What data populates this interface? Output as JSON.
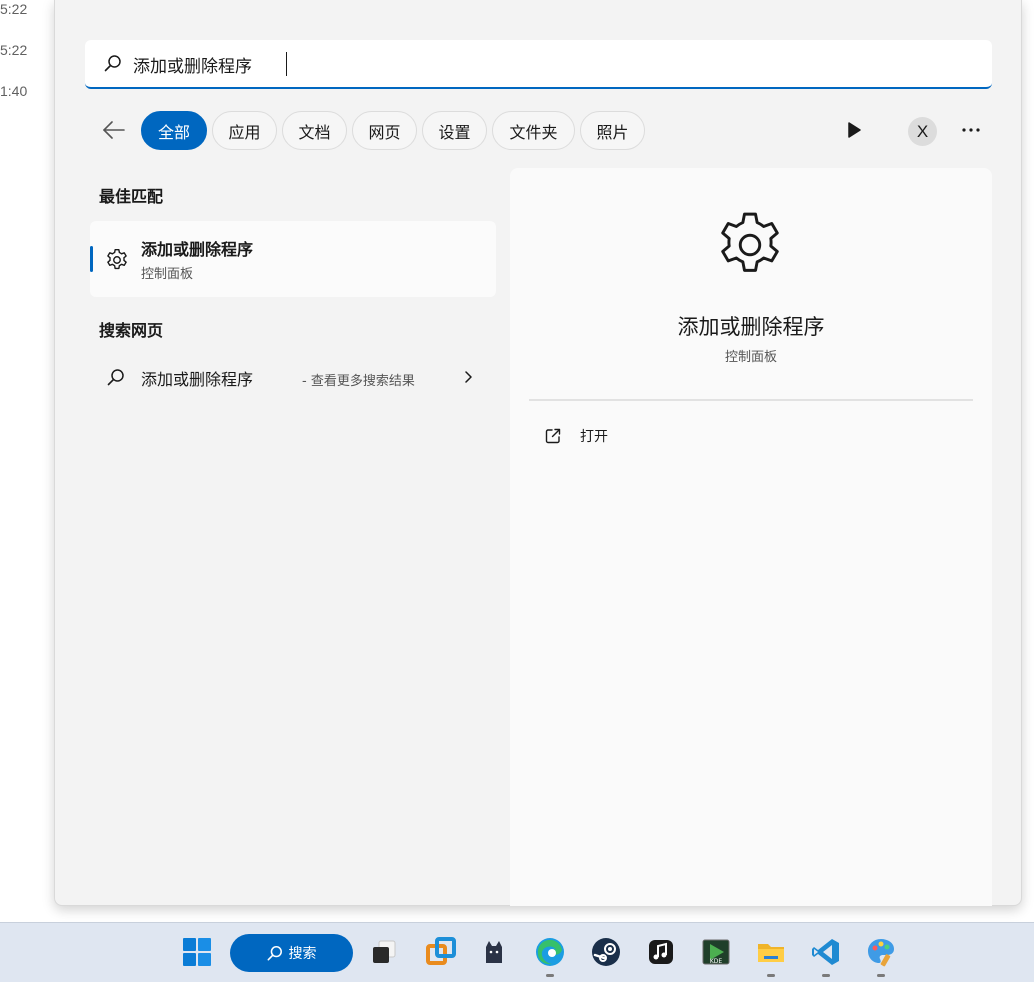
{
  "background_times": [
    "5:22",
    "5:22",
    "1:40"
  ],
  "search": {
    "value": "添加或删除程序",
    "placeholder": ""
  },
  "filters": [
    {
      "label": "全部",
      "active": true
    },
    {
      "label": "应用"
    },
    {
      "label": "文档"
    },
    {
      "label": "网页"
    },
    {
      "label": "设置"
    },
    {
      "label": "文件夹"
    },
    {
      "label": "照片"
    }
  ],
  "account": {
    "initial": "X"
  },
  "best_match": {
    "heading": "最佳匹配",
    "title": "添加或删除程序",
    "subtitle": "控制面板",
    "icon": "gear-icon"
  },
  "web_search": {
    "heading": "搜索网页",
    "query": "添加或删除程序",
    "suffix": "- 查看更多搜索结果"
  },
  "detail": {
    "title": "添加或删除程序",
    "subtitle": "控制面板",
    "actions": [
      {
        "label": "打开",
        "icon": "open-external-icon"
      }
    ]
  },
  "taskbar": {
    "search_label": "搜索",
    "apps": [
      "windows-start-icon",
      "search-button",
      "task-view-icon",
      "vmware-icon",
      "cat-app-icon",
      "edge-icon",
      "steam-icon",
      "music-app-icon",
      "media-player-icon",
      "file-explorer-icon",
      "vscode-icon",
      "paint-icon"
    ]
  },
  "colors": {
    "accent": "#0067c0",
    "panel_bg": "#f3f3f3",
    "taskbar_bg": "#dfe6f1"
  }
}
